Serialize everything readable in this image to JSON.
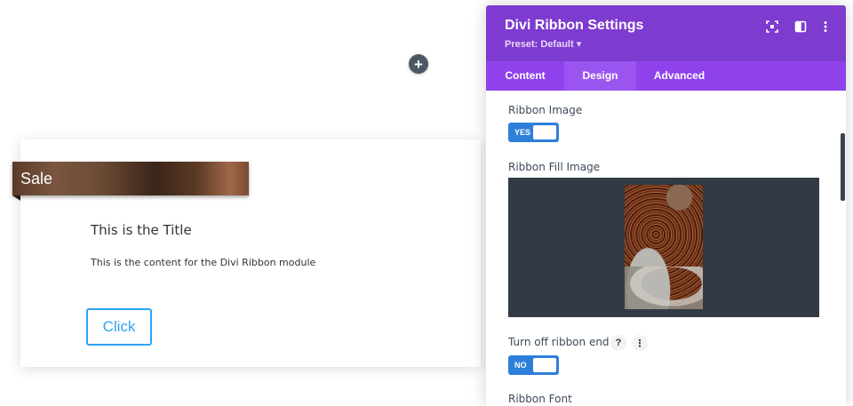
{
  "canvas": {
    "add_button": "+",
    "ribbon_label": "Sale",
    "title": "This is the Title",
    "content": "This is the content for the Divi Ribbon module",
    "button_label": "Click"
  },
  "panel": {
    "title": "Divi Ribbon Settings",
    "preset": "Preset: Default ▾",
    "header_icons": [
      "focus-icon",
      "sidebar-icon",
      "more-vertical-icon"
    ],
    "tabs": [
      {
        "label": "Content",
        "active": false
      },
      {
        "label": "Design",
        "active": true
      },
      {
        "label": "Advanced",
        "active": false
      }
    ],
    "fields": {
      "ribbon_image_label": "Ribbon Image",
      "ribbon_image_toggle": "YES",
      "ribbon_fill_image_label": "Ribbon Fill Image",
      "turn_off_end_label": "Turn off ribbon end",
      "help_glyph": "?",
      "more_glyph": "⋮",
      "turn_off_end_toggle": "NO",
      "ribbon_font_label": "Ribbon Font"
    }
  },
  "colors": {
    "header": "#7e3bd0",
    "tabs": "#8f42ec",
    "active_tab": "#9a55f0",
    "toggle": "#2e7fd9",
    "button_accent": "#2ea3f2"
  }
}
